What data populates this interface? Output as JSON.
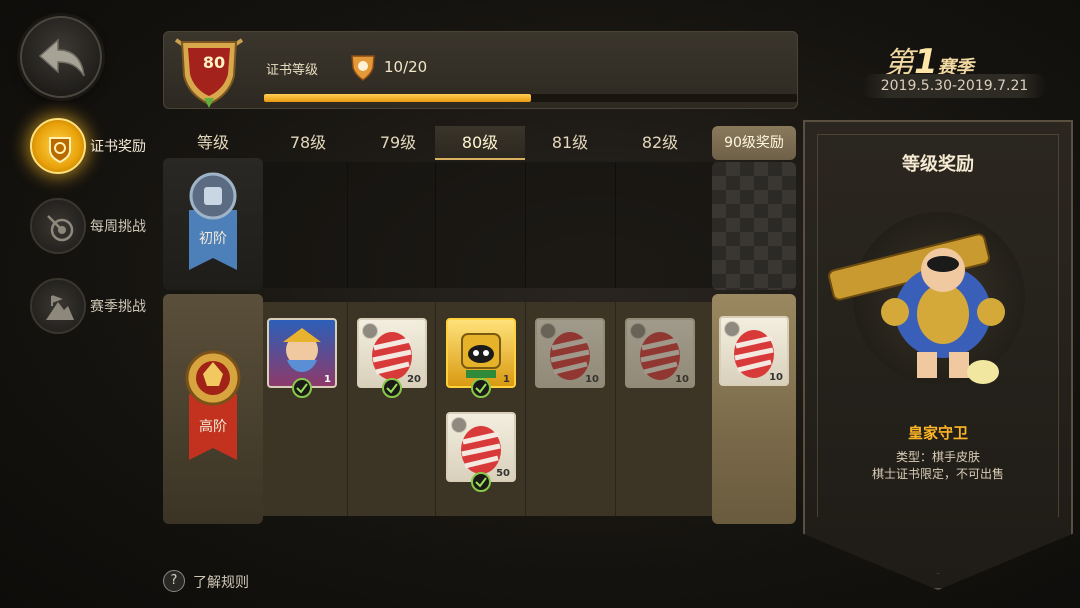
{
  "nav": {
    "back_icon": "back-arrow-icon",
    "items": [
      {
        "label": "证书奖励",
        "icon": "certificate-icon",
        "active": true
      },
      {
        "label": "每周挑战",
        "icon": "target-icon",
        "active": false
      },
      {
        "label": "赛季挑战",
        "icon": "mountain-flag-icon",
        "active": false
      }
    ]
  },
  "header": {
    "level": "80",
    "cert_label": "证书等级",
    "progress_text": "10/20",
    "progress_fraction": 0.5
  },
  "season": {
    "prefix": "第",
    "number": "1",
    "suffix": "赛季",
    "dates": "2019.5.30-2019.7.21"
  },
  "table": {
    "corner_label": "等级",
    "columns": [
      "78级",
      "79级",
      "80级",
      "81级",
      "82级"
    ],
    "selected_column": "80级",
    "reward90_label": "90级奖励",
    "tier_basic": "初阶",
    "tier_advanced": "高阶",
    "advanced_items": [
      {
        "count": "1",
        "kind": "hero-card",
        "claimed": true
      },
      {
        "count": "20",
        "kind": "egg",
        "claimed": true
      },
      {
        "count": "1",
        "kind": "hero-card-gold",
        "claimed": true
      },
      {
        "count": "10",
        "kind": "egg",
        "claimed": false
      },
      {
        "count": "10",
        "kind": "egg",
        "claimed": false
      },
      {
        "count": "50",
        "kind": "egg",
        "claimed": true
      },
      {
        "count": "10",
        "kind": "egg",
        "claimed": false
      }
    ]
  },
  "reward_panel": {
    "title": "等级奖励",
    "hero_name": "皇家守卫",
    "type_text": "类型：棋手皮肤",
    "note": "棋士证书限定，不可出售"
  },
  "footer": {
    "rules_icon": "?",
    "rules_text": "了解规则"
  },
  "colors": {
    "accent_gold": "#e89a10",
    "hero_name": "#ffb626",
    "check_green": "#88c94a"
  }
}
